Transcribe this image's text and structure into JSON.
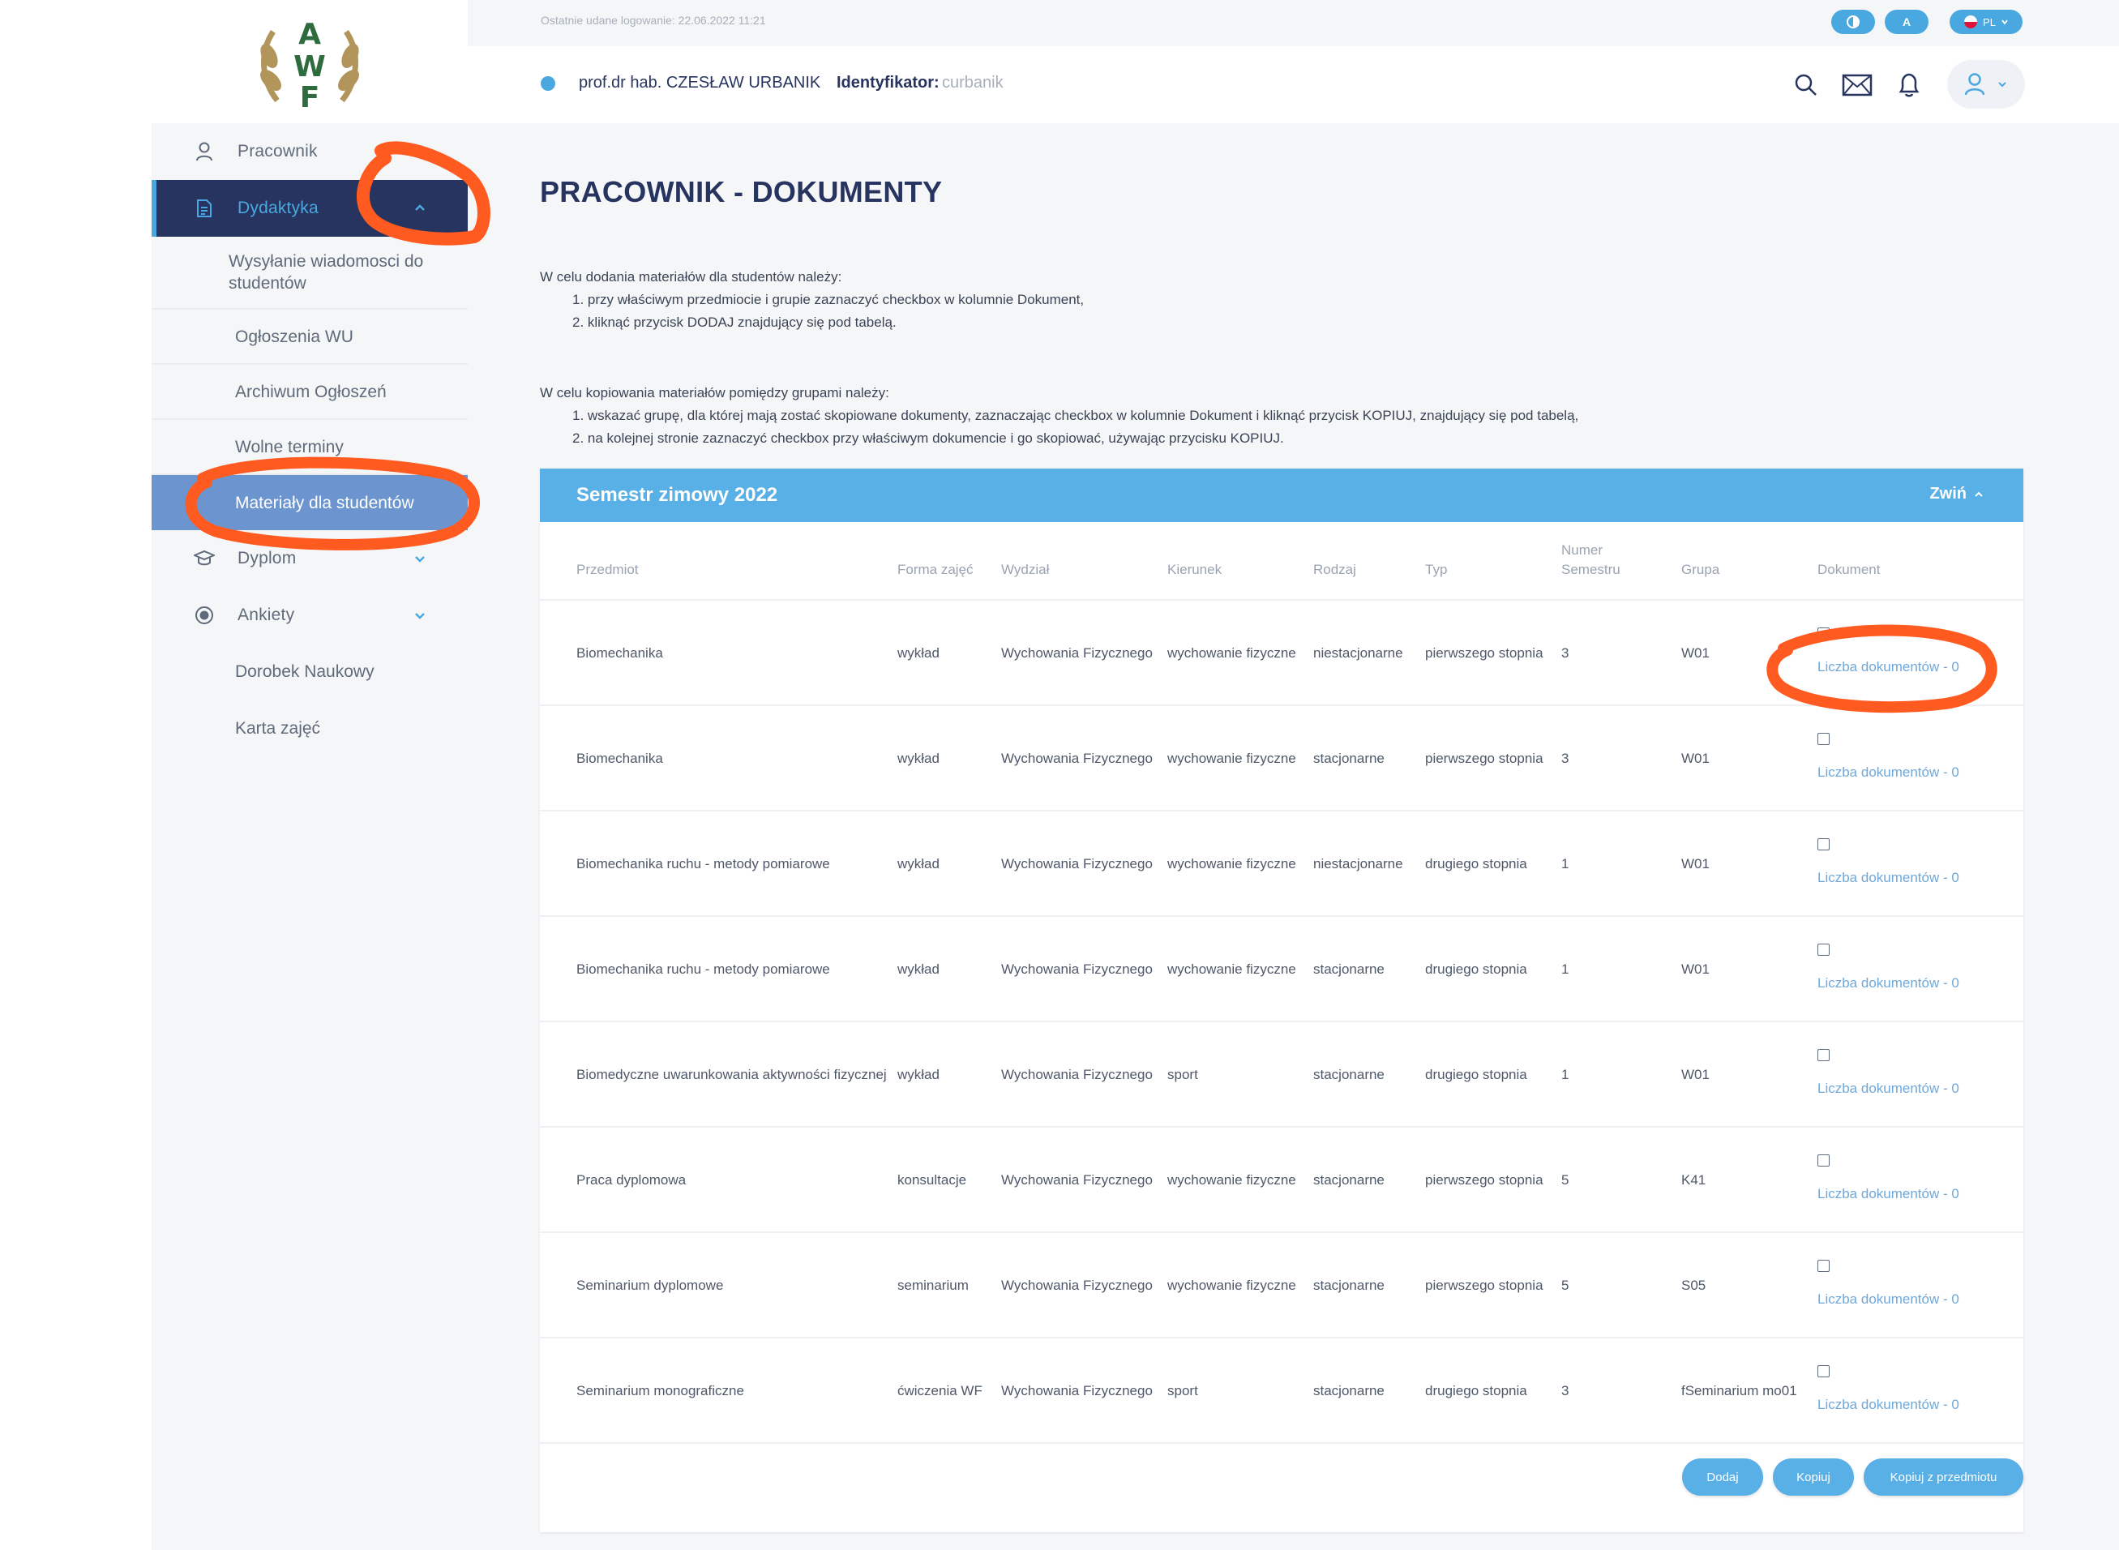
{
  "logo": {
    "letters": "AWF"
  },
  "topbar": {
    "last_login": "Ostatnie udane logowanie: 22.06.2022 11:21",
    "contrast_icon": "contrast-icon",
    "font_label": "A",
    "lang_label": "PL"
  },
  "user": {
    "name": "prof.dr hab. CZESŁAW URBANIK",
    "id_label": "Identyfikator:",
    "id_value": "curbanik"
  },
  "sidebar": {
    "pracownik": "Pracownik",
    "dydaktyka": "Dydaktyka",
    "sub_items": [
      "Wysyłanie wiadomosci do studentów",
      "Ogłoszenia WU",
      "Archiwum Ogłoszeń",
      "Wolne terminy",
      "Materiały dla studentów"
    ],
    "dyplom": "Dyplom",
    "ankiety": "Ankiety",
    "dorobek": "Dorobek Naukowy",
    "karta": "Karta zajęć"
  },
  "page": {
    "title": "PRACOWNIK - DOKUMENTY",
    "instr1_head": "W celu dodania materiałów dla studentów należy:",
    "instr1_items": [
      "1. przy właściwym przedmiocie i grupie zaznaczyć checkbox w kolumnie Dokument,",
      "2. kliknąć przycisk DODAJ znajdujący się pod tabelą."
    ],
    "instr2_head": "W celu kopiowania materiałów pomiędzy grupami należy:",
    "instr2_items": [
      "1. wskazać grupę, dla której mają zostać skopiowane dokumenty, zaznaczając checkbox w kolumnie Dokument i kliknąć przycisk KOPIUJ, znajdujący się pod tabelą,",
      "2. na kolejnej stronie zaznaczyć checkbox przy właściwym dokumencie i go skopiować, używając przycisku KOPIUJ."
    ]
  },
  "panel": {
    "title": "Semestr zimowy 2022",
    "toggle": "Zwiń"
  },
  "table": {
    "headers": [
      "Przedmiot",
      "Forma zajęć",
      "Wydział",
      "Kierunek",
      "Rodzaj",
      "Typ",
      "Numer Semestru",
      "Grupa",
      "Dokument"
    ],
    "rows": [
      {
        "przedmiot": "Biomechanika",
        "forma": "wykład",
        "wydzial": "Wychowania Fizycznego",
        "kierunek": "wychowanie fizyczne",
        "rodzaj": "niestacjonarne",
        "typ": "pierwszego stopnia",
        "semestr": "3",
        "grupa": "W01",
        "dokument": "Liczba dokumentów - 0"
      },
      {
        "przedmiot": "Biomechanika",
        "forma": "wykład",
        "wydzial": "Wychowania Fizycznego",
        "kierunek": "wychowanie fizyczne",
        "rodzaj": "stacjonarne",
        "typ": "pierwszego stopnia",
        "semestr": "3",
        "grupa": "W01",
        "dokument": "Liczba dokumentów - 0"
      },
      {
        "przedmiot": "Biomechanika ruchu - metody pomiarowe",
        "forma": "wykład",
        "wydzial": "Wychowania Fizycznego",
        "kierunek": "wychowanie fizyczne",
        "rodzaj": "niestacjonarne",
        "typ": "drugiego stopnia",
        "semestr": "1",
        "grupa": "W01",
        "dokument": "Liczba dokumentów - 0"
      },
      {
        "przedmiot": "Biomechanika ruchu - metody pomiarowe",
        "forma": "wykład",
        "wydzial": "Wychowania Fizycznego",
        "kierunek": "wychowanie fizyczne",
        "rodzaj": "stacjonarne",
        "typ": "drugiego stopnia",
        "semestr": "1",
        "grupa": "W01",
        "dokument": "Liczba dokumentów - 0"
      },
      {
        "przedmiot": "Biomedyczne uwarunkowania aktywności fizycznej",
        "forma": "wykład",
        "wydzial": "Wychowania Fizycznego",
        "kierunek": "sport",
        "rodzaj": "stacjonarne",
        "typ": "drugiego stopnia",
        "semestr": "1",
        "grupa": "W01",
        "dokument": "Liczba dokumentów - 0"
      },
      {
        "przedmiot": "Praca dyplomowa",
        "forma": "konsultacje",
        "wydzial": "Wychowania Fizycznego",
        "kierunek": "wychowanie fizyczne",
        "rodzaj": "stacjonarne",
        "typ": "pierwszego stopnia",
        "semestr": "5",
        "grupa": "K41",
        "dokument": "Liczba dokumentów - 0"
      },
      {
        "przedmiot": "Seminarium dyplomowe",
        "forma": "seminarium",
        "wydzial": "Wychowania Fizycznego",
        "kierunek": "wychowanie fizyczne",
        "rodzaj": "stacjonarne",
        "typ": "pierwszego stopnia",
        "semestr": "5",
        "grupa": "S05",
        "dokument": "Liczba dokumentów - 0"
      },
      {
        "przedmiot": "Seminarium monograficzne",
        "forma": "ćwiczenia WF",
        "wydzial": "Wychowania Fizycznego",
        "kierunek": "sport",
        "rodzaj": "stacjonarne",
        "typ": "drugiego stopnia",
        "semestr": "3",
        "grupa": "fSeminarium mo01",
        "dokument": "Liczba dokumentów - 0"
      }
    ]
  },
  "buttons": {
    "dodaj": "Dodaj",
    "kopiuj": "Kopiuj",
    "kopiuj_z": "Kopiuj z przedmiotu"
  },
  "colors": {
    "accent": "#59b0e6",
    "navy": "#27345f",
    "selected": "#6c95d0",
    "annotation": "#ff5a1f"
  }
}
